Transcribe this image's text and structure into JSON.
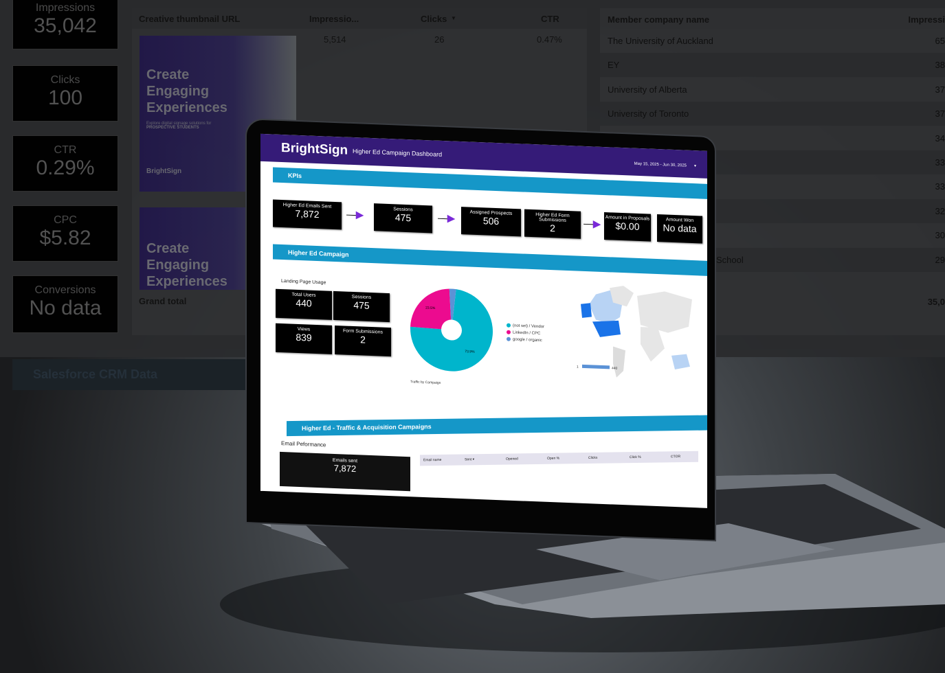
{
  "background_dashboard": {
    "kpis": [
      {
        "label": "Impressions",
        "value": "35,042"
      },
      {
        "label": "Clicks",
        "value": "100"
      },
      {
        "label": "CTR",
        "value": "0.29%"
      },
      {
        "label": "CPC",
        "value": "$5.82"
      },
      {
        "label": "Conversions",
        "value": "No data"
      }
    ],
    "creative_table": {
      "headers": [
        "Creative thumbnail URL",
        "Impressio...",
        "Clicks",
        "CTR"
      ],
      "sort_indicator": "▼",
      "row": {
        "impressions": "5,514",
        "clicks": "26",
        "ctr": "0.47%"
      },
      "thumbnail_text": [
        "Create Engaging Experiences",
        "Explore digital signage solutions for",
        "PROSPECTIVE STUDENTS",
        "BrightSign"
      ],
      "grand_total_label": "Grand total"
    },
    "company_table": {
      "headers": [
        "Member company name",
        "Impressi"
      ],
      "rows": [
        {
          "name": "The University of Auckland",
          "value": "65"
        },
        {
          "name": "EY",
          "value": "38"
        },
        {
          "name": "University of Alberta",
          "value": "37"
        },
        {
          "name": "University of Toronto",
          "value": "37"
        },
        {
          "name": "",
          "value": "34"
        },
        {
          "name": "",
          "value": "33"
        },
        {
          "name": "",
          "value": "33"
        },
        {
          "name": "",
          "value": "32"
        },
        {
          "name": "",
          "value": "30"
        },
        {
          "name": "School",
          "value": "29"
        }
      ],
      "grand_total": "35,0"
    },
    "section_title": "Salesforce CRM Data"
  },
  "laptop_dashboard": {
    "brand": "BrightSign",
    "title": "Higher Ed Campaign Dashboard",
    "date_range": "May 15, 2025 - Jun 30, 2025",
    "colors": {
      "header": "#351b78",
      "band": "#1597c8",
      "arrow": "#7a2ad8"
    },
    "kpis_title": "KPIs",
    "kpis": [
      {
        "label": "Higher Ed Emails Sent",
        "value": "7,872"
      },
      {
        "label": "Sessions",
        "value": "475"
      },
      {
        "label": "Assigned Prospects",
        "value": "506"
      },
      {
        "label": "Higher Ed Form Submissions",
        "value": "2"
      },
      {
        "label": "Amount in Proposals",
        "value": "$0.00"
      },
      {
        "label": "Amount Won",
        "value": "No data"
      }
    ],
    "campaign_title": "Higher Ed Campaign",
    "landing_title": "Landing Page Usage",
    "landing": [
      {
        "label": "Total Users",
        "value": "440"
      },
      {
        "label": "Sessions",
        "value": "475"
      },
      {
        "label": "Views",
        "value": "839"
      },
      {
        "label": "Form Submissions",
        "value": "2"
      }
    ],
    "pie": {
      "caption": "Traffic by Campaign",
      "slices": [
        {
          "name": "(not set) / Vendor",
          "value": 73.9,
          "label": "73.9%",
          "color": "#00b5cc"
        },
        {
          "name": "LinkedIn / CPC",
          "value": 23.5,
          "label": "23.5%",
          "color": "#ec0b8f"
        },
        {
          "name": "google / organic",
          "value": 2.6,
          "color": "#5b92d6"
        }
      ]
    },
    "map": {
      "min": "1",
      "max": "440"
    },
    "traffic_title": "Higher Ed - Traffic & Acquisition Campaigns",
    "email_title": "Email Peformance",
    "emails_sent": {
      "label": "Emails sent",
      "value": "7,872"
    },
    "email_table": {
      "headers": [
        "Email name",
        "Sent ▾",
        "Opened",
        "Open %",
        "Clicks",
        "Click %",
        "CTOR"
      ]
    }
  }
}
